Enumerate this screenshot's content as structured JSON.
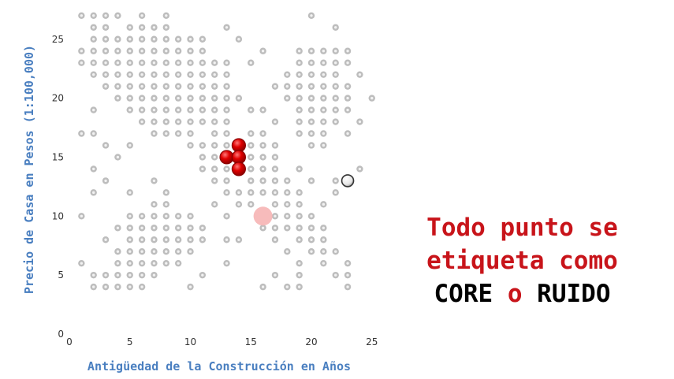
{
  "colors": {
    "point_fill": "#bdbdbd",
    "point_center": "#f2f2f2",
    "core": "#e00000",
    "core_dark": "#8a0000",
    "faded_core": "#f6b4b4",
    "axis_title": "#4a7fc0",
    "caption_red": "#c8141a",
    "caption_black": "#000000"
  },
  "caption": {
    "line1": "Todo punto se",
    "line2": "etiqueta como",
    "word_core": "CORE",
    "word_o": "o",
    "word_ruido": "RUIDO"
  },
  "chart_data": {
    "type": "scatter",
    "xlabel": "Antigüedad de la Construcción en Años",
    "ylabel": "Precio de Casa en Pesos (1:100,000)",
    "xlim": [
      0,
      25
    ],
    "ylim": [
      0,
      27
    ],
    "xticks": [
      0,
      5,
      10,
      15,
      20,
      25
    ],
    "yticks": [
      0,
      5,
      10,
      15,
      20,
      25
    ],
    "grid": false,
    "points": [
      [
        1,
        27
      ],
      [
        2,
        27
      ],
      [
        3,
        27
      ],
      [
        4,
        27
      ],
      [
        6,
        27
      ],
      [
        8,
        27
      ],
      [
        20,
        27
      ],
      [
        2,
        26
      ],
      [
        3,
        26
      ],
      [
        5,
        26
      ],
      [
        6,
        26
      ],
      [
        7,
        26
      ],
      [
        8,
        26
      ],
      [
        13,
        26
      ],
      [
        22,
        26
      ],
      [
        2,
        25
      ],
      [
        3,
        25
      ],
      [
        4,
        25
      ],
      [
        5,
        25
      ],
      [
        6,
        25
      ],
      [
        7,
        25
      ],
      [
        8,
        25
      ],
      [
        9,
        25
      ],
      [
        10,
        25
      ],
      [
        11,
        25
      ],
      [
        14,
        25
      ],
      [
        1,
        24
      ],
      [
        2,
        24
      ],
      [
        3,
        24
      ],
      [
        4,
        24
      ],
      [
        5,
        24
      ],
      [
        6,
        24
      ],
      [
        7,
        24
      ],
      [
        8,
        24
      ],
      [
        9,
        24
      ],
      [
        10,
        24
      ],
      [
        11,
        24
      ],
      [
        16,
        24
      ],
      [
        19,
        24
      ],
      [
        20,
        24
      ],
      [
        21,
        24
      ],
      [
        22,
        24
      ],
      [
        23,
        24
      ],
      [
        1,
        23
      ],
      [
        2,
        23
      ],
      [
        3,
        23
      ],
      [
        4,
        23
      ],
      [
        5,
        23
      ],
      [
        6,
        23
      ],
      [
        7,
        23
      ],
      [
        8,
        23
      ],
      [
        9,
        23
      ],
      [
        10,
        23
      ],
      [
        11,
        23
      ],
      [
        12,
        23
      ],
      [
        13,
        23
      ],
      [
        15,
        23
      ],
      [
        19,
        23
      ],
      [
        20,
        23
      ],
      [
        21,
        23
      ],
      [
        22,
        23
      ],
      [
        23,
        23
      ],
      [
        2,
        22
      ],
      [
        3,
        22
      ],
      [
        4,
        22
      ],
      [
        5,
        22
      ],
      [
        6,
        22
      ],
      [
        7,
        22
      ],
      [
        8,
        22
      ],
      [
        9,
        22
      ],
      [
        10,
        22
      ],
      [
        11,
        22
      ],
      [
        12,
        22
      ],
      [
        13,
        22
      ],
      [
        18,
        22
      ],
      [
        19,
        22
      ],
      [
        20,
        22
      ],
      [
        21,
        22
      ],
      [
        22,
        22
      ],
      [
        24,
        22
      ],
      [
        3,
        21
      ],
      [
        4,
        21
      ],
      [
        5,
        21
      ],
      [
        6,
        21
      ],
      [
        7,
        21
      ],
      [
        8,
        21
      ],
      [
        9,
        21
      ],
      [
        10,
        21
      ],
      [
        11,
        21
      ],
      [
        12,
        21
      ],
      [
        13,
        21
      ],
      [
        17,
        21
      ],
      [
        18,
        21
      ],
      [
        19,
        21
      ],
      [
        20,
        21
      ],
      [
        21,
        21
      ],
      [
        22,
        21
      ],
      [
        23,
        21
      ],
      [
        4,
        20
      ],
      [
        5,
        20
      ],
      [
        6,
        20
      ],
      [
        7,
        20
      ],
      [
        8,
        20
      ],
      [
        9,
        20
      ],
      [
        10,
        20
      ],
      [
        11,
        20
      ],
      [
        12,
        20
      ],
      [
        13,
        20
      ],
      [
        14,
        20
      ],
      [
        18,
        20
      ],
      [
        19,
        20
      ],
      [
        20,
        20
      ],
      [
        21,
        20
      ],
      [
        22,
        20
      ],
      [
        23,
        20
      ],
      [
        25,
        20
      ],
      [
        2,
        19
      ],
      [
        5,
        19
      ],
      [
        6,
        19
      ],
      [
        7,
        19
      ],
      [
        8,
        19
      ],
      [
        9,
        19
      ],
      [
        10,
        19
      ],
      [
        11,
        19
      ],
      [
        12,
        19
      ],
      [
        13,
        19
      ],
      [
        15,
        19
      ],
      [
        16,
        19
      ],
      [
        19,
        19
      ],
      [
        20,
        19
      ],
      [
        21,
        19
      ],
      [
        22,
        19
      ],
      [
        23,
        19
      ],
      [
        6,
        18
      ],
      [
        7,
        18
      ],
      [
        8,
        18
      ],
      [
        9,
        18
      ],
      [
        10,
        18
      ],
      [
        11,
        18
      ],
      [
        12,
        18
      ],
      [
        13,
        18
      ],
      [
        17,
        18
      ],
      [
        19,
        18
      ],
      [
        20,
        18
      ],
      [
        21,
        18
      ],
      [
        22,
        18
      ],
      [
        24,
        18
      ],
      [
        1,
        17
      ],
      [
        2,
        17
      ],
      [
        7,
        17
      ],
      [
        8,
        17
      ],
      [
        9,
        17
      ],
      [
        10,
        17
      ],
      [
        12,
        17
      ],
      [
        13,
        17
      ],
      [
        15,
        17
      ],
      [
        16,
        17
      ],
      [
        19,
        17
      ],
      [
        20,
        17
      ],
      [
        21,
        17
      ],
      [
        23,
        17
      ],
      [
        3,
        16
      ],
      [
        5,
        16
      ],
      [
        10,
        16
      ],
      [
        11,
        16
      ],
      [
        12,
        16
      ],
      [
        13,
        16
      ],
      [
        15,
        16
      ],
      [
        16,
        16
      ],
      [
        17,
        16
      ],
      [
        20,
        16
      ],
      [
        21,
        16
      ],
      [
        4,
        15
      ],
      [
        11,
        15
      ],
      [
        12,
        15
      ],
      [
        15,
        15
      ],
      [
        16,
        15
      ],
      [
        17,
        15
      ],
      [
        2,
        14
      ],
      [
        11,
        14
      ],
      [
        12,
        14
      ],
      [
        13,
        14
      ],
      [
        15,
        14
      ],
      [
        16,
        14
      ],
      [
        17,
        14
      ],
      [
        19,
        14
      ],
      [
        24,
        14
      ],
      [
        3,
        13
      ],
      [
        7,
        13
      ],
      [
        12,
        13
      ],
      [
        13,
        13
      ],
      [
        15,
        13
      ],
      [
        16,
        13
      ],
      [
        17,
        13
      ],
      [
        18,
        13
      ],
      [
        20,
        13
      ],
      [
        22,
        13
      ],
      [
        2,
        12
      ],
      [
        5,
        12
      ],
      [
        8,
        12
      ],
      [
        13,
        12
      ],
      [
        14,
        12
      ],
      [
        15,
        12
      ],
      [
        16,
        12
      ],
      [
        17,
        12
      ],
      [
        18,
        12
      ],
      [
        19,
        12
      ],
      [
        22,
        12
      ],
      [
        7,
        11
      ],
      [
        8,
        11
      ],
      [
        12,
        11
      ],
      [
        14,
        11
      ],
      [
        15,
        11
      ],
      [
        17,
        11
      ],
      [
        18,
        11
      ],
      [
        19,
        11
      ],
      [
        21,
        11
      ],
      [
        1,
        10
      ],
      [
        5,
        10
      ],
      [
        6,
        10
      ],
      [
        7,
        10
      ],
      [
        8,
        10
      ],
      [
        9,
        10
      ],
      [
        10,
        10
      ],
      [
        13,
        10
      ],
      [
        17,
        10
      ],
      [
        18,
        10
      ],
      [
        19,
        10
      ],
      [
        20,
        10
      ],
      [
        4,
        9
      ],
      [
        5,
        9
      ],
      [
        6,
        9
      ],
      [
        7,
        9
      ],
      [
        8,
        9
      ],
      [
        9,
        9
      ],
      [
        10,
        9
      ],
      [
        11,
        9
      ],
      [
        16,
        9
      ],
      [
        17,
        9
      ],
      [
        18,
        9
      ],
      [
        19,
        9
      ],
      [
        20,
        9
      ],
      [
        21,
        9
      ],
      [
        3,
        8
      ],
      [
        5,
        8
      ],
      [
        6,
        8
      ],
      [
        7,
        8
      ],
      [
        8,
        8
      ],
      [
        9,
        8
      ],
      [
        10,
        8
      ],
      [
        11,
        8
      ],
      [
        13,
        8
      ],
      [
        14,
        8
      ],
      [
        17,
        8
      ],
      [
        19,
        8
      ],
      [
        20,
        8
      ],
      [
        21,
        8
      ],
      [
        4,
        7
      ],
      [
        5,
        7
      ],
      [
        6,
        7
      ],
      [
        7,
        7
      ],
      [
        8,
        7
      ],
      [
        9,
        7
      ],
      [
        10,
        7
      ],
      [
        18,
        7
      ],
      [
        20,
        7
      ],
      [
        21,
        7
      ],
      [
        22,
        7
      ],
      [
        1,
        6
      ],
      [
        4,
        6
      ],
      [
        5,
        6
      ],
      [
        6,
        6
      ],
      [
        7,
        6
      ],
      [
        8,
        6
      ],
      [
        9,
        6
      ],
      [
        13,
        6
      ],
      [
        19,
        6
      ],
      [
        21,
        6
      ],
      [
        23,
        6
      ],
      [
        2,
        5
      ],
      [
        3,
        5
      ],
      [
        4,
        5
      ],
      [
        5,
        5
      ],
      [
        6,
        5
      ],
      [
        7,
        5
      ],
      [
        11,
        5
      ],
      [
        17,
        5
      ],
      [
        19,
        5
      ],
      [
        22,
        5
      ],
      [
        23,
        5
      ],
      [
        2,
        4
      ],
      [
        3,
        4
      ],
      [
        4,
        4
      ],
      [
        5,
        4
      ],
      [
        6,
        4
      ],
      [
        10,
        4
      ],
      [
        16,
        4
      ],
      [
        18,
        4
      ],
      [
        19,
        4
      ],
      [
        23,
        4
      ]
    ],
    "core_points": [
      [
        14,
        16
      ],
      [
        13,
        15
      ],
      [
        14,
        15
      ],
      [
        14,
        14
      ]
    ],
    "faded_core_point": [
      16,
      10
    ],
    "noise_point": [
      23,
      13
    ]
  }
}
